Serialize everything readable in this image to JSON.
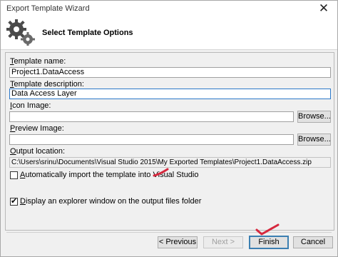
{
  "window": {
    "title": "Export Template Wizard",
    "close_glyph": "✕"
  },
  "header": {
    "title": "Select Template Options",
    "icon": "gears-icon"
  },
  "form": {
    "template_name": {
      "label_key": "T",
      "label_rest": "emplate name:",
      "value": "Project1.DataAccess"
    },
    "template_description": {
      "label_key": "T",
      "label_rest": "emplate description:",
      "value": "Data Access Layer"
    },
    "icon_image": {
      "label_key": "I",
      "label_rest": "con Image:",
      "value": "",
      "browse_label": "Browse..."
    },
    "preview_image": {
      "label_key": "P",
      "label_rest": "review Image:",
      "value": "",
      "browse_label": "Browse..."
    },
    "output_location": {
      "label_key": "O",
      "label_rest": "utput location:",
      "value": "C:\\Users\\srinu\\Documents\\Visual Studio 2015\\My Exported Templates\\Project1.DataAccess.zip"
    },
    "auto_import": {
      "label_key": "A",
      "label_rest": "utomatically import the template into Visual Studio",
      "checked": false
    },
    "display_explorer": {
      "label_key": "D",
      "label_rest": "isplay an explorer window on the output files folder",
      "checked": true
    }
  },
  "footer": {
    "previous_label": "< Previous",
    "next_label": "Next >",
    "finish_label": "Finish",
    "cancel_label": "Cancel"
  },
  "colors": {
    "annotation": "#d6283e",
    "focus": "#2b78c9"
  }
}
